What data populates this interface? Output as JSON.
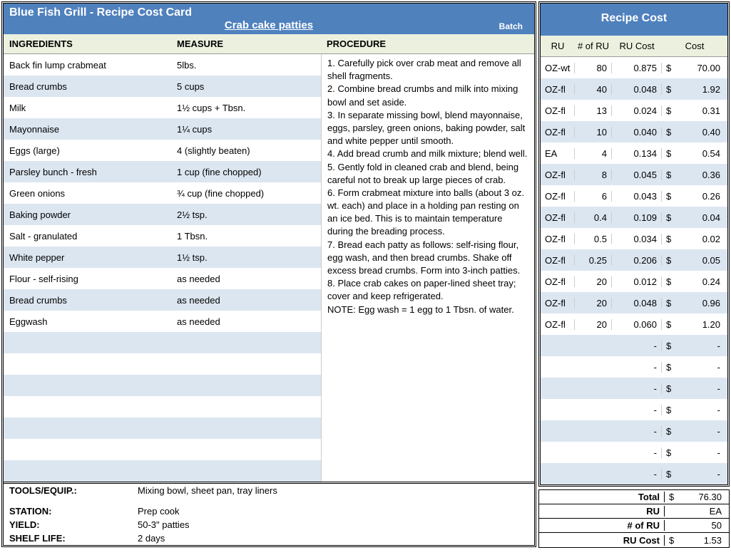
{
  "header": {
    "title": "Blue Fish Grill - Recipe Cost Card",
    "recipe": "Crab cake patties",
    "batch": "Batch"
  },
  "cols": {
    "ing": "INGREDIENTS",
    "mea": "MEASURE",
    "pro": "PROCEDURE"
  },
  "ingredients": [
    {
      "n": "Back fin lump crabmeat",
      "m": "5lbs."
    },
    {
      "n": "Bread crumbs",
      "m": "5 cups"
    },
    {
      "n": "Milk",
      "m": "1½ cups + Tbsn."
    },
    {
      "n": "Mayonnaise",
      "m": "1¼ cups"
    },
    {
      "n": "Eggs (large)",
      "m": "4 (slightly beaten)"
    },
    {
      "n": "Parsley bunch - fresh",
      "m": "1 cup (fine chopped)"
    },
    {
      "n": "Green onions",
      "m": "¾ cup (fine chopped)"
    },
    {
      "n": "Baking powder",
      "m": "2½ tsp."
    },
    {
      "n": "Salt - granulated",
      "m": "1 Tbsn."
    },
    {
      "n": "White pepper",
      "m": "1½ tsp."
    },
    {
      "n": "Flour - self-rising",
      "m": "as needed"
    },
    {
      "n": "Bread crumbs",
      "m": "as needed"
    },
    {
      "n": "Eggwash",
      "m": "as needed"
    },
    {
      "n": "",
      "m": ""
    },
    {
      "n": "",
      "m": ""
    },
    {
      "n": "",
      "m": ""
    },
    {
      "n": "",
      "m": ""
    },
    {
      "n": "",
      "m": ""
    },
    {
      "n": "",
      "m": ""
    },
    {
      "n": "",
      "m": ""
    }
  ],
  "procedure": [
    "1. Carefully pick over crab meat and remove all shell fragments.",
    "2. Combine bread crumbs and milk into mixing bowl and set aside.",
    "3. In separate missing bowl, blend mayonnaise, eggs, parsley, green onions, baking powder, salt and white pepper until smooth.",
    "4. Add bread crumb and milk mixture; blend well.",
    "5. Gently fold in cleaned crab and blend, being careful not to break up large pieces of crab.",
    "6. Form crabmeat mixture into balls (about 3 oz. wt. each) and place in a holding pan resting on an ice bed. This is to maintain temperature during the breading process.",
    "7. Bread each patty as follows: self-rising flour, egg wash, and then bread crumbs. Shake off excess bread crumbs. Form into 3-inch patties.",
    "8. Place crab cakes on paper-lined sheet tray; cover and keep refrigerated.",
    "NOTE: Egg wash = 1 egg to 1 Tbsn. of water."
  ],
  "footer": {
    "tools_l": "TOOLS/EQUIP.:",
    "tools_v": "Mixing bowl, sheet pan, tray liners",
    "station_l": "STATION:",
    "station_v": "Prep cook",
    "yield_l": "YIELD:",
    "yield_v": "50-3\" patties",
    "shelf_l": "SHELF LIFE:",
    "shelf_v": "2 days"
  },
  "rtitle": "Recipe Cost",
  "rcols": {
    "ru": "RU",
    "nru": "# of RU",
    "rucost": "RU Cost",
    "cost": "Cost"
  },
  "costs": [
    {
      "ru": "OZ-wt",
      "n": "80",
      "c": "0.875",
      "d": "$",
      "t": "70.00"
    },
    {
      "ru": "OZ-fl",
      "n": "40",
      "c": "0.048",
      "d": "$",
      "t": "1.92"
    },
    {
      "ru": "OZ-fl",
      "n": "13",
      "c": "0.024",
      "d": "$",
      "t": "0.31"
    },
    {
      "ru": "OZ-fl",
      "n": "10",
      "c": "0.040",
      "d": "$",
      "t": "0.40"
    },
    {
      "ru": "EA",
      "n": "4",
      "c": "0.134",
      "d": "$",
      "t": "0.54"
    },
    {
      "ru": "OZ-fl",
      "n": "8",
      "c": "0.045",
      "d": "$",
      "t": "0.36"
    },
    {
      "ru": "OZ-fl",
      "n": "6",
      "c": "0.043",
      "d": "$",
      "t": "0.26"
    },
    {
      "ru": "OZ-fl",
      "n": "0.4",
      "c": "0.109",
      "d": "$",
      "t": "0.04"
    },
    {
      "ru": "OZ-fl",
      "n": "0.5",
      "c": "0.034",
      "d": "$",
      "t": "0.02"
    },
    {
      "ru": "OZ-fl",
      "n": "0.25",
      "c": "0.206",
      "d": "$",
      "t": "0.05"
    },
    {
      "ru": "OZ-fl",
      "n": "20",
      "c": "0.012",
      "d": "$",
      "t": "0.24"
    },
    {
      "ru": "OZ-fl",
      "n": "20",
      "c": "0.048",
      "d": "$",
      "t": "0.96"
    },
    {
      "ru": "OZ-fl",
      "n": "20",
      "c": "0.060",
      "d": "$",
      "t": "1.20"
    },
    {
      "ru": "",
      "n": "",
      "c": "-",
      "d": "$",
      "t": "-"
    },
    {
      "ru": "",
      "n": "",
      "c": "-",
      "d": "$",
      "t": "-"
    },
    {
      "ru": "",
      "n": "",
      "c": "-",
      "d": "$",
      "t": "-"
    },
    {
      "ru": "",
      "n": "",
      "c": "-",
      "d": "$",
      "t": "-"
    },
    {
      "ru": "",
      "n": "",
      "c": "-",
      "d": "$",
      "t": "-"
    },
    {
      "ru": "",
      "n": "",
      "c": "-",
      "d": "$",
      "t": "-"
    },
    {
      "ru": "",
      "n": "",
      "c": "-",
      "d": "$",
      "t": "-"
    }
  ],
  "summary": [
    {
      "l": "Total",
      "d": "$",
      "v": "76.30"
    },
    {
      "l": "RU",
      "d": "",
      "v": "EA"
    },
    {
      "l": "# of RU",
      "d": "",
      "v": "50"
    },
    {
      "l": "RU Cost",
      "d": "$",
      "v": "1.53"
    }
  ]
}
